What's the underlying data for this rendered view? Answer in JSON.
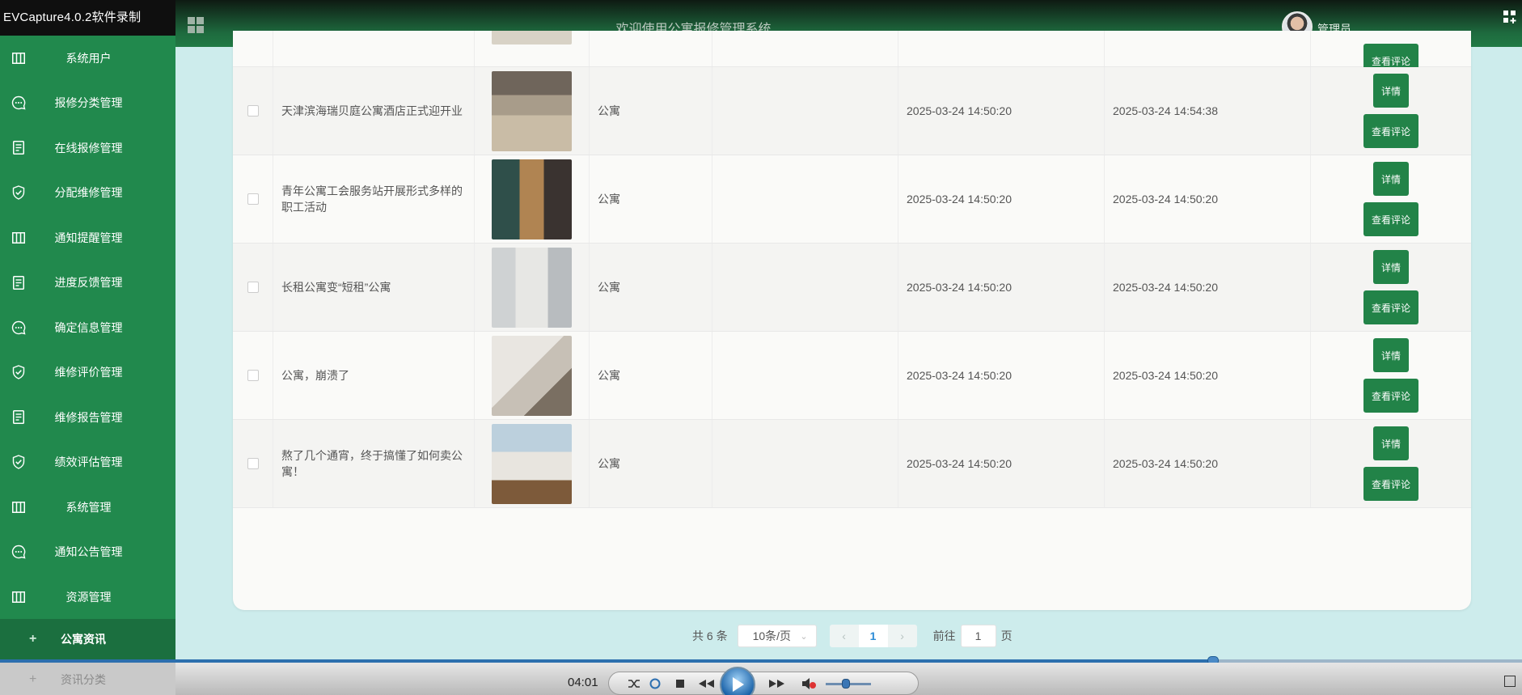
{
  "app": {
    "window_title": "EVCapture4.0.2软件录制"
  },
  "header": {
    "title": "欢迎使用公寓报修管理系统",
    "user_name": "管理员"
  },
  "sidebar": {
    "items": [
      {
        "label": "系统用户",
        "icon": "grid-icon"
      },
      {
        "label": "报修分类管理",
        "icon": "chat-icon"
      },
      {
        "label": "在线报修管理",
        "icon": "document-icon"
      },
      {
        "label": "分配维修管理",
        "icon": "shield-check-icon"
      },
      {
        "label": "通知提醒管理",
        "icon": "grid-icon"
      },
      {
        "label": "进度反馈管理",
        "icon": "document-icon"
      },
      {
        "label": "确定信息管理",
        "icon": "chat-icon"
      },
      {
        "label": "维修评价管理",
        "icon": "shield-check-icon"
      },
      {
        "label": "维修报告管理",
        "icon": "document-icon"
      },
      {
        "label": "绩效评估管理",
        "icon": "shield-check-icon"
      },
      {
        "label": "系统管理",
        "icon": "grid-icon"
      },
      {
        "label": "通知公告管理",
        "icon": "chat-icon"
      },
      {
        "label": "资源管理",
        "icon": "grid-icon"
      }
    ],
    "sub_items": [
      {
        "label": "公寓资讯",
        "active": true
      },
      {
        "label": "资讯分类",
        "active": false
      }
    ]
  },
  "table": {
    "rows": [
      {
        "title": "",
        "category": "",
        "created": "",
        "updated": "",
        "partial": true
      },
      {
        "title": "天津滨海瑞贝庭公寓酒店正式迎开业",
        "category": "公寓",
        "created": "2025-03-24 14:50:20",
        "updated": "2025-03-24 14:54:38"
      },
      {
        "title": "青年公寓工会服务站开展形式多样的职工活动",
        "category": "公寓",
        "created": "2025-03-24 14:50:20",
        "updated": "2025-03-24 14:50:20"
      },
      {
        "title": "长租公寓变“短租”公寓",
        "category": "公寓",
        "created": "2025-03-24 14:50:20",
        "updated": "2025-03-24 14:50:20"
      },
      {
        "title": "公寓，崩溃了",
        "category": "公寓",
        "created": "2025-03-24 14:50:20",
        "updated": "2025-03-24 14:50:20"
      },
      {
        "title": "熬了几个通宵，终于搞懂了如何卖公寓！",
        "category": "公寓",
        "created": "2025-03-24 14:50:20",
        "updated": "2025-03-24 14:50:20"
      }
    ],
    "detail_label": "详情",
    "review_label": "查看评论"
  },
  "pagination": {
    "total": "共 6 条",
    "page_size": "10条/页",
    "current_page": "1",
    "goto_prefix": "前往",
    "goto_value": "1",
    "goto_suffix": "页"
  },
  "player": {
    "time": "04:01",
    "progress": 0.797,
    "volume": 0.45
  },
  "colors": {
    "primary": "#228348",
    "sidebar": "#21894d",
    "background": "#cdecec"
  }
}
